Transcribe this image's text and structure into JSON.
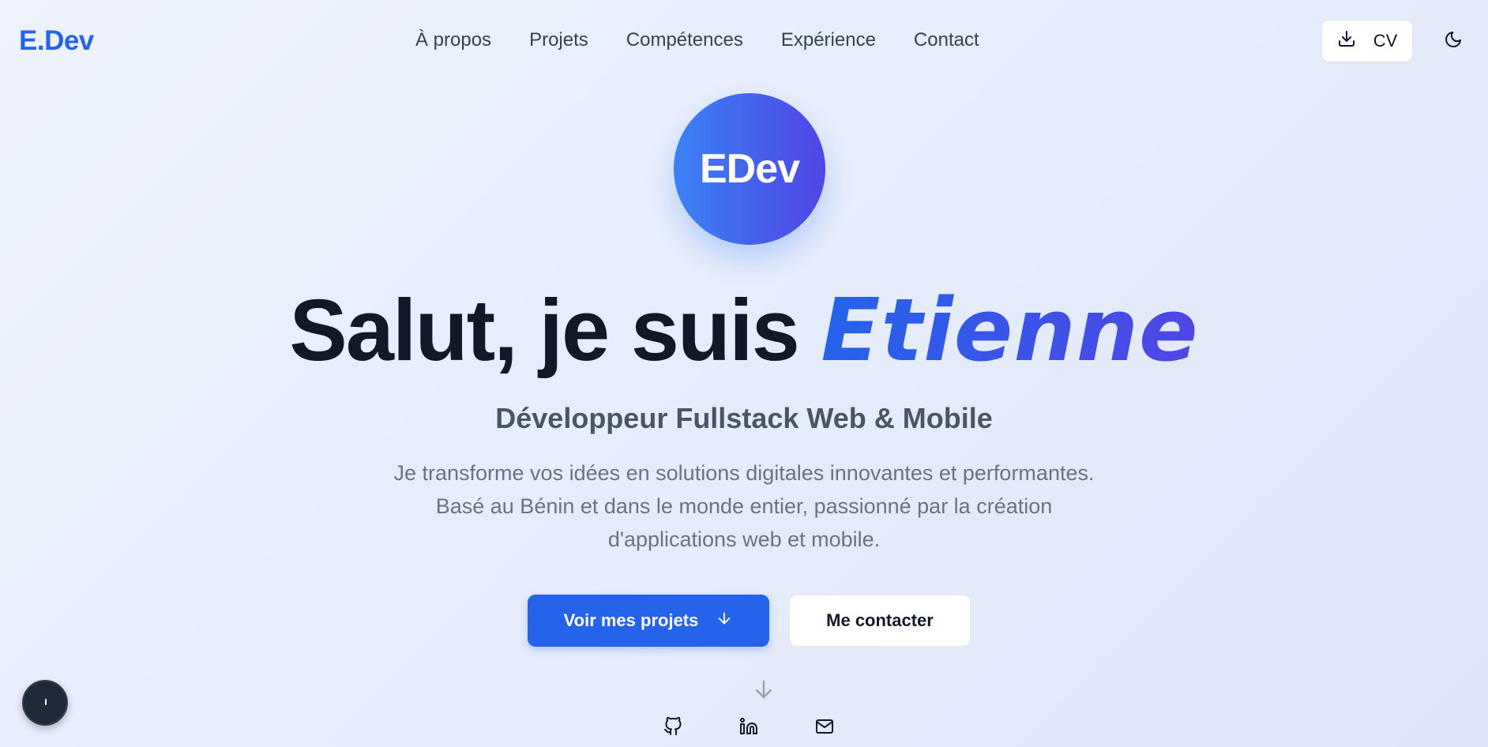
{
  "header": {
    "logo": "E.Dev",
    "nav": [
      "À propos",
      "Projets",
      "Compétences",
      "Expérience",
      "Contact"
    ],
    "cv_label": "CV",
    "cv_icon": "download-icon",
    "theme_icon": "moon-icon"
  },
  "hero": {
    "avatar_text": "EDev",
    "greeting": "Salut, je suis ",
    "name": "Etienne",
    "subtitle": "Développeur Fullstack Web & Mobile",
    "description_lines": [
      "Je transforme vos idées en solutions digitales innovantes et performantes.",
      "Basé au Bénin et dans le monde entier, passionné par la création",
      "d'applications web et mobile."
    ],
    "primary_button": "Voir mes projets",
    "secondary_button": "Me contacter",
    "scroll_icon": "arrow-down-icon",
    "socials": [
      "github-icon",
      "linkedin-icon",
      "mail-icon"
    ]
  },
  "colors": {
    "accent": "#2563eb",
    "accent_end": "#4f46e5",
    "text_dark": "#111827",
    "text_muted": "#6b7280"
  }
}
